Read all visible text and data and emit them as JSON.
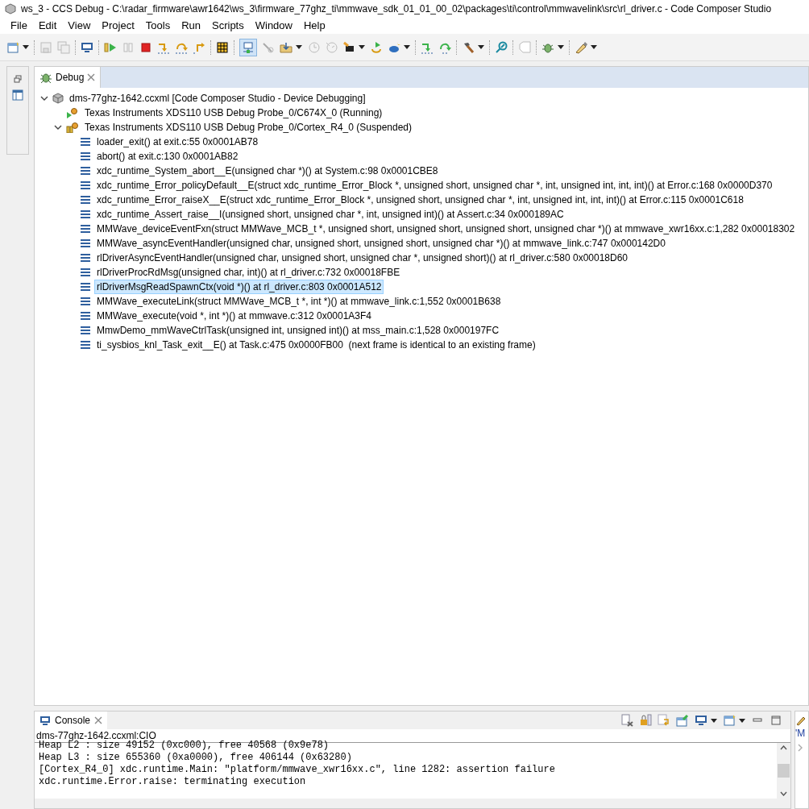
{
  "window": {
    "title": "ws_3 - CCS Debug - C:\\radar_firmware\\awr1642\\ws_3\\firmware_77ghz_ti\\mmwave_sdk_01_01_00_02\\packages\\ti\\control\\mmwavelink\\src\\rl_driver.c - Code Composer Studio"
  },
  "menu": [
    "File",
    "Edit",
    "View",
    "Project",
    "Tools",
    "Run",
    "Scripts",
    "Window",
    "Help"
  ],
  "debug_view": {
    "tab": {
      "label": "Debug",
      "selected": true
    },
    "tree": [
      {
        "label": "dms-77ghz-1642.ccxml [Code Composer Studio - Device Debugging]",
        "kind": "config",
        "expanded": true,
        "children": [
          {
            "label": "Texas Instruments XDS110 USB Debug Probe_0/C674X_0 (Running)",
            "kind": "running"
          },
          {
            "label": "Texas Instruments XDS110 USB Debug Probe_0/Cortex_R4_0 (Suspended)",
            "kind": "suspended",
            "expanded": true,
            "children": [
              {
                "label": "loader_exit() at exit.c:55 0x0001AB78",
                "kind": "frame",
                "selected": false
              },
              {
                "label": "abort() at exit.c:130 0x0001AB82",
                "kind": "frame",
                "selected": false
              },
              {
                "label": "xdc_runtime_System_abort__E(unsigned char *)() at System.c:98 0x0001CBE8",
                "kind": "frame",
                "selected": false
              },
              {
                "label": "xdc_runtime_Error_policyDefault__E(struct xdc_runtime_Error_Block *, unsigned short, unsigned char *, int, unsigned int, int, int)() at Error.c:168 0x0000D370",
                "kind": "frame",
                "selected": false
              },
              {
                "label": "xdc_runtime_Error_raiseX__E(struct xdc_runtime_Error_Block *, unsigned short, unsigned char *, int, unsigned int, int, int)() at Error.c:115 0x0001C618",
                "kind": "frame",
                "selected": false
              },
              {
                "label": "xdc_runtime_Assert_raise__I(unsigned short, unsigned char *, int, unsigned int)() at Assert.c:34 0x000189AC",
                "kind": "frame",
                "selected": false
              },
              {
                "label": "MMWave_deviceEventFxn(struct MMWave_MCB_t *, unsigned short, unsigned short, unsigned short, unsigned char *)() at mmwave_xwr16xx.c:1,282 0x00018302",
                "kind": "frame",
                "selected": false
              },
              {
                "label": "MMWave_asyncEventHandler(unsigned char, unsigned short, unsigned short, unsigned char *)() at mmwave_link.c:747 0x000142D0",
                "kind": "frame",
                "selected": false
              },
              {
                "label": "rlDriverAsyncEventHandler(unsigned char, unsigned short, unsigned char *, unsigned short)() at rl_driver.c:580 0x00018D60",
                "kind": "frame",
                "selected": false
              },
              {
                "label": "rlDriverProcRdMsg(unsigned char, int)() at rl_driver.c:732 0x00018FBE",
                "kind": "frame",
                "selected": false
              },
              {
                "label": "rlDriverMsgReadSpawnCtx(void *)() at rl_driver.c:803 0x0001A512",
                "kind": "frame",
                "selected": true
              },
              {
                "label": "MMWave_executeLink(struct MMWave_MCB_t *, int *)() at mmwave_link.c:1,552 0x0001B638",
                "kind": "frame",
                "selected": false
              },
              {
                "label": "MMWave_execute(void *, int *)() at mmwave.c:312 0x0001A3F4",
                "kind": "frame",
                "selected": false
              },
              {
                "label": "MmwDemo_mmWaveCtrlTask(unsigned int, unsigned int)() at mss_main.c:1,528 0x000197FC",
                "kind": "frame",
                "selected": false
              },
              {
                "label": "ti_sysbios_knl_Task_exit__E() at Task.c:475 0x0000FB00  (next frame is identical to an existing frame)",
                "kind": "frame",
                "selected": false
              }
            ]
          }
        ]
      }
    ]
  },
  "console": {
    "tab": {
      "label": "Console",
      "selected": true
    },
    "source": "dms-77ghz-1642.ccxml:CIO",
    "lines": [
      "Heap L2 : size 49152 (0xc000), free 40568 (0x9e78)",
      "Heap L3 : size 655360 (0xa0000), free 406144 (0x63280)",
      "[Cortex_R4_0] xdc.runtime.Main: \"platform/mmwave_xwr16xx.c\", line 1282: assertion failure",
      "xdc.runtime.Error.raise: terminating execution"
    ]
  },
  "side_panel": {
    "text": "'M"
  }
}
